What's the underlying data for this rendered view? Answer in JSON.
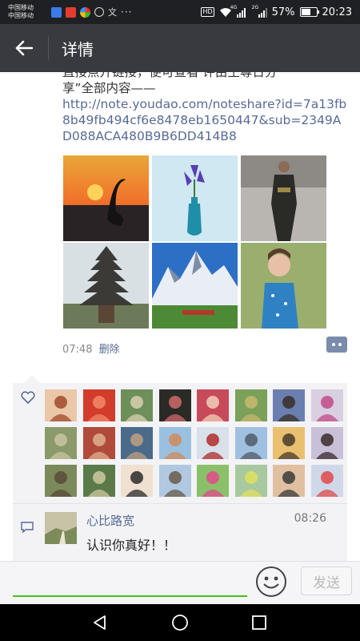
{
  "status_bar": {
    "carrier_1": "中国移动",
    "carrier_2": "中国移动",
    "network_1": "4G",
    "network_2": "2G",
    "battery": "57%",
    "time": "20:23",
    "hd_label": "HD",
    "overflow": "···"
  },
  "header": {
    "title": "详情"
  },
  "post": {
    "text_cut_line": "直接点开链接，便可查看 评由王尊日分",
    "text_line": "享”全部内容——",
    "link": "http://note.youdao.com/noteshare?id=7a13fb8b49fb494cf6e8478eb1650447&sub=2349AD088ACA480B9B6DD414B8",
    "photos": [
      "sunset-crane",
      "iris-in-bottle",
      "runway-model",
      "pagoda-tower",
      "snow-mountain-train",
      "woman-blue-dress"
    ],
    "time": "07:48",
    "delete_label": "删除"
  },
  "likes": {
    "avatar_count": 24
  },
  "comment": {
    "author": "心比路宽",
    "time": "08:26",
    "text": "认识你真好！！"
  },
  "input": {
    "placeholder": "",
    "send_label": "发送"
  },
  "colors": {
    "link": "#576b95",
    "appbar": "#393a3f",
    "input_accent": "#45c01a"
  }
}
